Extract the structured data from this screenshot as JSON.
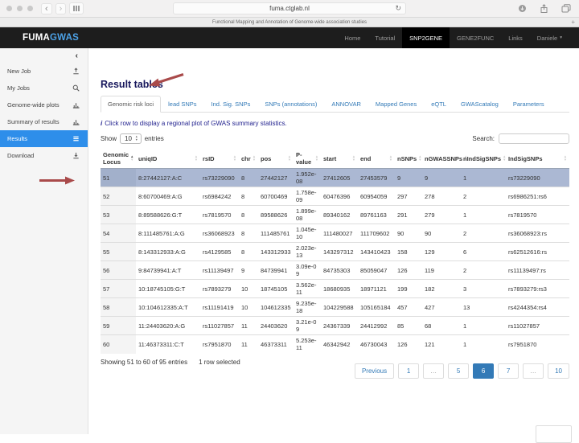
{
  "browser": {
    "url": "fuma.ctglab.nl",
    "tab_title": "Functional Mapping and Annotation of Genome-wide association studies",
    "back_glyph": "‹",
    "forward_glyph": "›",
    "reload_glyph": "↻",
    "new_tab_glyph": "+"
  },
  "navbar": {
    "brand_primary": "FUMA",
    "brand_secondary": "GWAS",
    "items": [
      {
        "label": "Home",
        "active": false
      },
      {
        "label": "Tutorial",
        "active": false
      },
      {
        "label": "SNP2GENE",
        "active": true
      },
      {
        "label": "GENE2FUNC",
        "active": false
      },
      {
        "label": "Links",
        "active": false
      },
      {
        "label": "Daniele",
        "active": false,
        "caret": true
      }
    ]
  },
  "sidebar": {
    "collapse_glyph": "‹",
    "items": [
      {
        "label": "New Job",
        "icon": "upload-icon",
        "active": false
      },
      {
        "label": "My Jobs",
        "icon": "search-icon",
        "active": false
      },
      {
        "label": "Genome-wide plots",
        "icon": "chart-icon",
        "active": false
      },
      {
        "label": "Summary of results",
        "icon": "chart-icon",
        "active": false
      },
      {
        "label": "Results",
        "icon": "list-icon",
        "active": true
      },
      {
        "label": "Download",
        "icon": "download-icon",
        "active": false
      }
    ]
  },
  "main": {
    "title": "Result tables",
    "tabs": [
      {
        "label": "Genomic risk loci",
        "active": true
      },
      {
        "label": "lead SNPs",
        "active": false
      },
      {
        "label": "Ind. Sig. SNPs",
        "active": false
      },
      {
        "label": "SNPs (annotations)",
        "active": false
      },
      {
        "label": "ANNOVAR",
        "active": false
      },
      {
        "label": "Mapped Genes",
        "active": false
      },
      {
        "label": "eQTL",
        "active": false
      },
      {
        "label": "GWAScatalog",
        "active": false
      },
      {
        "label": "Parameters",
        "active": false
      }
    ],
    "info_icon": "i",
    "info_text": "Click row to display a regional plot of GWAS summary statistics.",
    "length_control": {
      "show_label": "Show",
      "value": "10",
      "entries_label": "entries"
    },
    "search": {
      "label": "Search:",
      "value": ""
    },
    "table": {
      "columns": [
        {
          "label": "Genomic Locus",
          "sorted": true
        },
        {
          "label": "uniqID",
          "sorted": false
        },
        {
          "label": "rsID",
          "sorted": false
        },
        {
          "label": "chr",
          "sorted": false
        },
        {
          "label": "pos",
          "sorted": false
        },
        {
          "label": "P-value",
          "sorted": false
        },
        {
          "label": "start",
          "sorted": false
        },
        {
          "label": "end",
          "sorted": false
        },
        {
          "label": "nSNPs",
          "sorted": false
        },
        {
          "label": "nGWASSNPs",
          "sorted": false
        },
        {
          "label": "nIndSigSNPs",
          "sorted": false
        },
        {
          "label": "IndSigSNPs",
          "sorted": false
        }
      ],
      "selected_row_index": 0,
      "rows": [
        [
          "51",
          "8:27442127:A:C",
          "rs73229090",
          "8",
          "27442127",
          "1.952e-08",
          "27412605",
          "27453579",
          "9",
          "9",
          "1",
          "rs73229090"
        ],
        [
          "52",
          "8:60700469:A:G",
          "rs6984242",
          "8",
          "60700469",
          "1.758e-09",
          "60476396",
          "60954059",
          "297",
          "278",
          "2",
          "rs6986251:rs6"
        ],
        [
          "53",
          "8:89588626:G:T",
          "rs7819570",
          "8",
          "89588626",
          "1.899e-08",
          "89340162",
          "89761163",
          "291",
          "279",
          "1",
          "rs7819570"
        ],
        [
          "54",
          "8:111485761:A:G",
          "rs36068923",
          "8",
          "111485761",
          "1.045e-10",
          "111480027",
          "111709602",
          "90",
          "90",
          "2",
          "rs36068923:rs"
        ],
        [
          "55",
          "8:143312933:A:G",
          "rs4129585",
          "8",
          "143312933",
          "2.023e-13",
          "143297312",
          "143410423",
          "158",
          "129",
          "6",
          "rs62512616:rs"
        ],
        [
          "56",
          "9:84739941:A:T",
          "rs11139497",
          "9",
          "84739941",
          "3.09e-09",
          "84735303",
          "85059047",
          "126",
          "119",
          "2",
          "rs11139497:rs"
        ],
        [
          "57",
          "10:18745105:G:T",
          "rs7893279",
          "10",
          "18745105",
          "3.562e-11",
          "18680935",
          "18971121",
          "199",
          "182",
          "3",
          "rs7893279:rs3"
        ],
        [
          "58",
          "10:104612335:A:T",
          "rs11191419",
          "10",
          "104612335",
          "9.235e-18",
          "104229588",
          "105165184",
          "457",
          "427",
          "13",
          "rs4244354:rs4"
        ],
        [
          "59",
          "11:24403620:A:G",
          "rs11027857",
          "11",
          "24403620",
          "3.21e-09",
          "24367339",
          "24412992",
          "85",
          "68",
          "1",
          "rs11027857"
        ],
        [
          "60",
          "11:46373311:C:T",
          "rs7951870",
          "11",
          "46373311",
          "5.253e-11",
          "46342942",
          "46730043",
          "126",
          "121",
          "1",
          "rs7951870"
        ]
      ]
    },
    "footer": {
      "showing_text": "Showing 51 to 60 of 95 entries",
      "selected_text": "1 row selected",
      "pagination": [
        {
          "label": "Previous",
          "active": false
        },
        {
          "label": "1",
          "active": false
        },
        {
          "label": "...",
          "active": false
        },
        {
          "label": "5",
          "active": false
        },
        {
          "label": "6",
          "active": true
        },
        {
          "label": "7",
          "active": false
        },
        {
          "label": "...",
          "active": false
        },
        {
          "label": "10",
          "active": false
        }
      ]
    }
  },
  "colors": {
    "navbar_bg": "#1d1d1d",
    "brand_secondary_color": "#4da3e8",
    "sidebar_active_bg": "#2e8eea",
    "link_blue": "#337ab7",
    "selected_row_bg": "#abb8d3",
    "pagination_active_bg": "#337ab7",
    "annotation_arrow_color": "#a94a4a"
  }
}
